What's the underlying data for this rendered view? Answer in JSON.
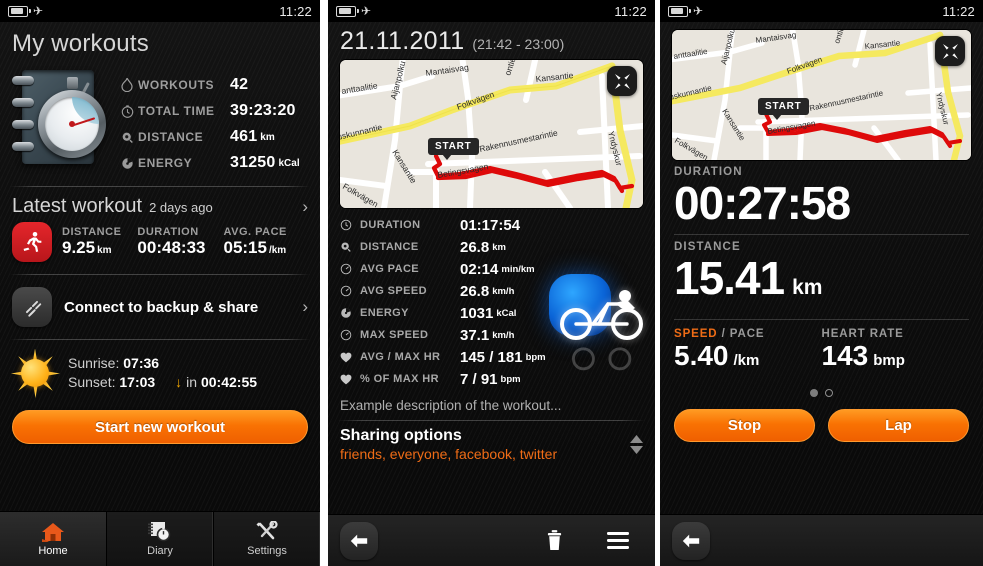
{
  "status": {
    "time": "11:22",
    "battery_icon": "battery-icon",
    "airplane_icon": "airplane-mode-icon"
  },
  "panel1": {
    "title": "My workouts",
    "hero_icon": "stopwatch-notebook-icon",
    "stats": [
      {
        "icon": "flame-icon",
        "label": "WORKOUTS",
        "value": "42",
        "unit": ""
      },
      {
        "icon": "clock-icon",
        "label": "TOTAL TIME",
        "value": "39:23:20",
        "unit": ""
      },
      {
        "icon": "distance-icon",
        "label": "DISTANCE",
        "value": "461",
        "unit": "km"
      },
      {
        "icon": "energy-icon",
        "label": "ENERGY",
        "value": "31250",
        "unit": "kCal"
      }
    ],
    "latest": {
      "heading": "Latest workout",
      "subheading": "2 days ago",
      "chevron": "›",
      "sport_icon": "running-icon",
      "metrics": [
        {
          "label": "DISTANCE",
          "value": "9.25",
          "unit": "km"
        },
        {
          "label": "DURATION",
          "value": "00:48:33",
          "unit": ""
        },
        {
          "label": "AVG. PACE",
          "value": "05:15",
          "unit": "/km"
        }
      ]
    },
    "connect": {
      "icon": "link-icon",
      "label": "Connect to backup & share",
      "chevron": "›"
    },
    "sun": {
      "icon": "sun-icon",
      "sunrise_label": "Sunrise:",
      "sunrise_value": "07:36",
      "sunset_label": "Sunset:",
      "sunset_value": "17:03",
      "countdown_arrow": "↓",
      "countdown_prefix": "in",
      "countdown_value": "00:42:55"
    },
    "start_button": "Start new workout",
    "tabs": [
      {
        "icon": "home-icon",
        "label": "Home",
        "active": true
      },
      {
        "icon": "diary-icon",
        "label": "Diary",
        "active": false
      },
      {
        "icon": "settings-icon",
        "label": "Settings",
        "active": false
      }
    ]
  },
  "panel2": {
    "date": "21.11.2011",
    "time_range": "(21:42 - 23:00)",
    "map": {
      "expand_icon": "expand-icon",
      "start_marker": "START",
      "labels": [
        "anttaalitie",
        "Aijanpolku",
        "Mantaisvag",
        "ontie",
        "Kansantie",
        "Folkvägen",
        "uskunnantie",
        "Kansantie",
        "Rakennusmestarintie",
        "Yndyskur",
        "Folkvägen",
        "Betingsvagen"
      ]
    },
    "details": [
      {
        "icon": "clock-icon",
        "label": "DURATION",
        "value": "01:17:54",
        "unit": ""
      },
      {
        "icon": "distance-icon",
        "label": "DISTANCE",
        "value": "26.8",
        "unit": "km"
      },
      {
        "icon": "pace-icon",
        "label": "AVG PACE",
        "value": "02:14",
        "unit": "min/km"
      },
      {
        "icon": "speed-icon",
        "label": "AVG SPEED",
        "value": "26.8",
        "unit": "km/h"
      },
      {
        "icon": "energy-icon",
        "label": "ENERGY",
        "value": "1031",
        "unit": "kCal"
      },
      {
        "icon": "speed-icon",
        "label": "MAX SPEED",
        "value": "37.1",
        "unit": "km/h"
      },
      {
        "icon": "heart-icon",
        "label": "AVG / MAX HR",
        "value": "145 / 181",
        "unit": "bpm"
      },
      {
        "icon": "heart-icon",
        "label": "% OF MAX HR",
        "value": "7 / 91",
        "unit": "bpm"
      }
    ],
    "sport_icon": "cycling-icon",
    "description": "Example description of the workout...",
    "sharing_title": "Sharing options",
    "sharing_value": "friends, everyone, facebook, twitter",
    "sharing_spinner_icon": "stepper-updown-icon",
    "bottom": {
      "back_icon": "back-arrow-icon",
      "delete_icon": "trash-icon",
      "menu_icon": "hamburger-menu-icon"
    }
  },
  "panel3": {
    "map": {
      "expand_icon": "expand-icon",
      "start_marker": "START"
    },
    "duration_label": "DURATION",
    "duration_value": "00:27:58",
    "distance_label": "DISTANCE",
    "distance_value": "15.41",
    "distance_unit": "km",
    "speed_label_hi": "SPEED",
    "speed_label_rest": " / PACE",
    "speed_value": "5.40",
    "speed_unit": "/km",
    "hr_label": "HEART RATE",
    "hr_value": "143",
    "hr_unit": "bmp",
    "pager": {
      "active_index": 0,
      "count": 2
    },
    "stop_button": "Stop",
    "lap_button": "Lap",
    "bottom": {
      "back_icon": "back-arrow-icon"
    }
  },
  "colors": {
    "accent_orange": "#ef6c16",
    "button_orange": "#f97203",
    "run_red": "#d41c21",
    "map_road": "#f6e96a",
    "track_red": "#e00000"
  }
}
